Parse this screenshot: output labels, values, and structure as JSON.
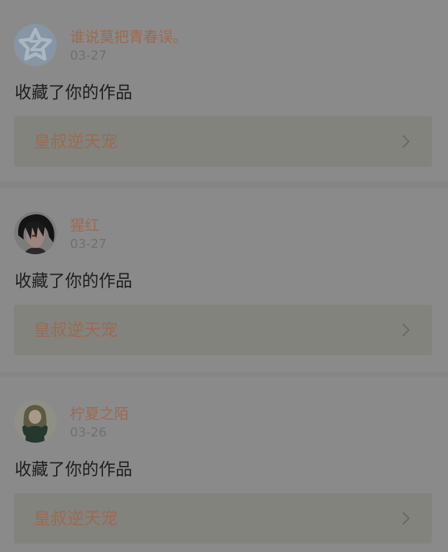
{
  "notifications": [
    {
      "username": "谁说莫把青春误。",
      "date": "03-27",
      "action": "收藏了你的作品",
      "work_title": "皇叔逆天宠",
      "avatar_icon": "default-star-avatar-icon"
    },
    {
      "username": "猩红",
      "date": "03-27",
      "action": "收藏了你的作品",
      "work_title": "皇叔逆天宠",
      "avatar_icon": "anime-boy-avatar-icon"
    },
    {
      "username": "柠夏之陌",
      "date": "03-26",
      "action": "收藏了你的作品",
      "work_title": "皇叔逆天宠",
      "avatar_icon": "anime-girl-avatar-icon"
    }
  ],
  "colors": {
    "overlay_background": "#858585",
    "card_background": "#8a8a8a",
    "username": "#9a6a52",
    "work_title": "#9a6a52",
    "date": "#707070",
    "action_text": "#1e1e1e",
    "work_box": "#82837d"
  }
}
